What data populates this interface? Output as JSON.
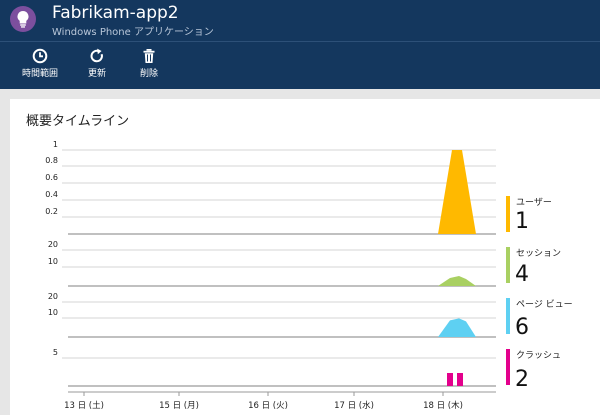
{
  "header": {
    "title": "Fabrikam-app2",
    "subtitle": "Windows Phone アプリケーション",
    "icon": "lightbulb-icon"
  },
  "toolbar": {
    "time_range_label": "時間範囲",
    "refresh_label": "更新",
    "delete_label": "削除"
  },
  "panel": {
    "title": "概要タイムライン"
  },
  "colors": {
    "header_bg": "#14375e",
    "users": "#ffb900",
    "sessions": "#a9d062",
    "pageviews": "#5ed0f2",
    "crashes": "#e3008c"
  },
  "chart_data": {
    "type": "area",
    "x": [
      "13 日 (土)",
      "15 日 (月)",
      "16 日 (火)",
      "17 日 (水)",
      "18 日 (木)"
    ],
    "panels": [
      {
        "name": "ユーザー",
        "total": "1",
        "color": "#ffb900",
        "y_ticks": [
          "1",
          "0.8",
          "0.6",
          "0.4",
          "0.2"
        ],
        "ylim": [
          0,
          1
        ],
        "values": [
          0,
          0,
          0,
          0,
          1
        ]
      },
      {
        "name": "セッション",
        "total": "4",
        "color": "#a9d062",
        "y_ticks": [
          "20",
          "10"
        ],
        "ylim": [
          0,
          20
        ],
        "values": [
          0,
          0,
          0,
          0,
          4
        ]
      },
      {
        "name": "ページ ビュー",
        "total": "6",
        "color": "#5ed0f2",
        "y_ticks": [
          "20",
          "10"
        ],
        "ylim": [
          0,
          20
        ],
        "values": [
          0,
          0,
          0,
          0,
          6
        ]
      },
      {
        "name": "クラッシュ",
        "total": "2",
        "color": "#e3008c",
        "y_ticks": [
          "5"
        ],
        "ylim": [
          0,
          5
        ],
        "values": [
          0,
          0,
          0,
          0,
          2
        ]
      }
    ]
  }
}
